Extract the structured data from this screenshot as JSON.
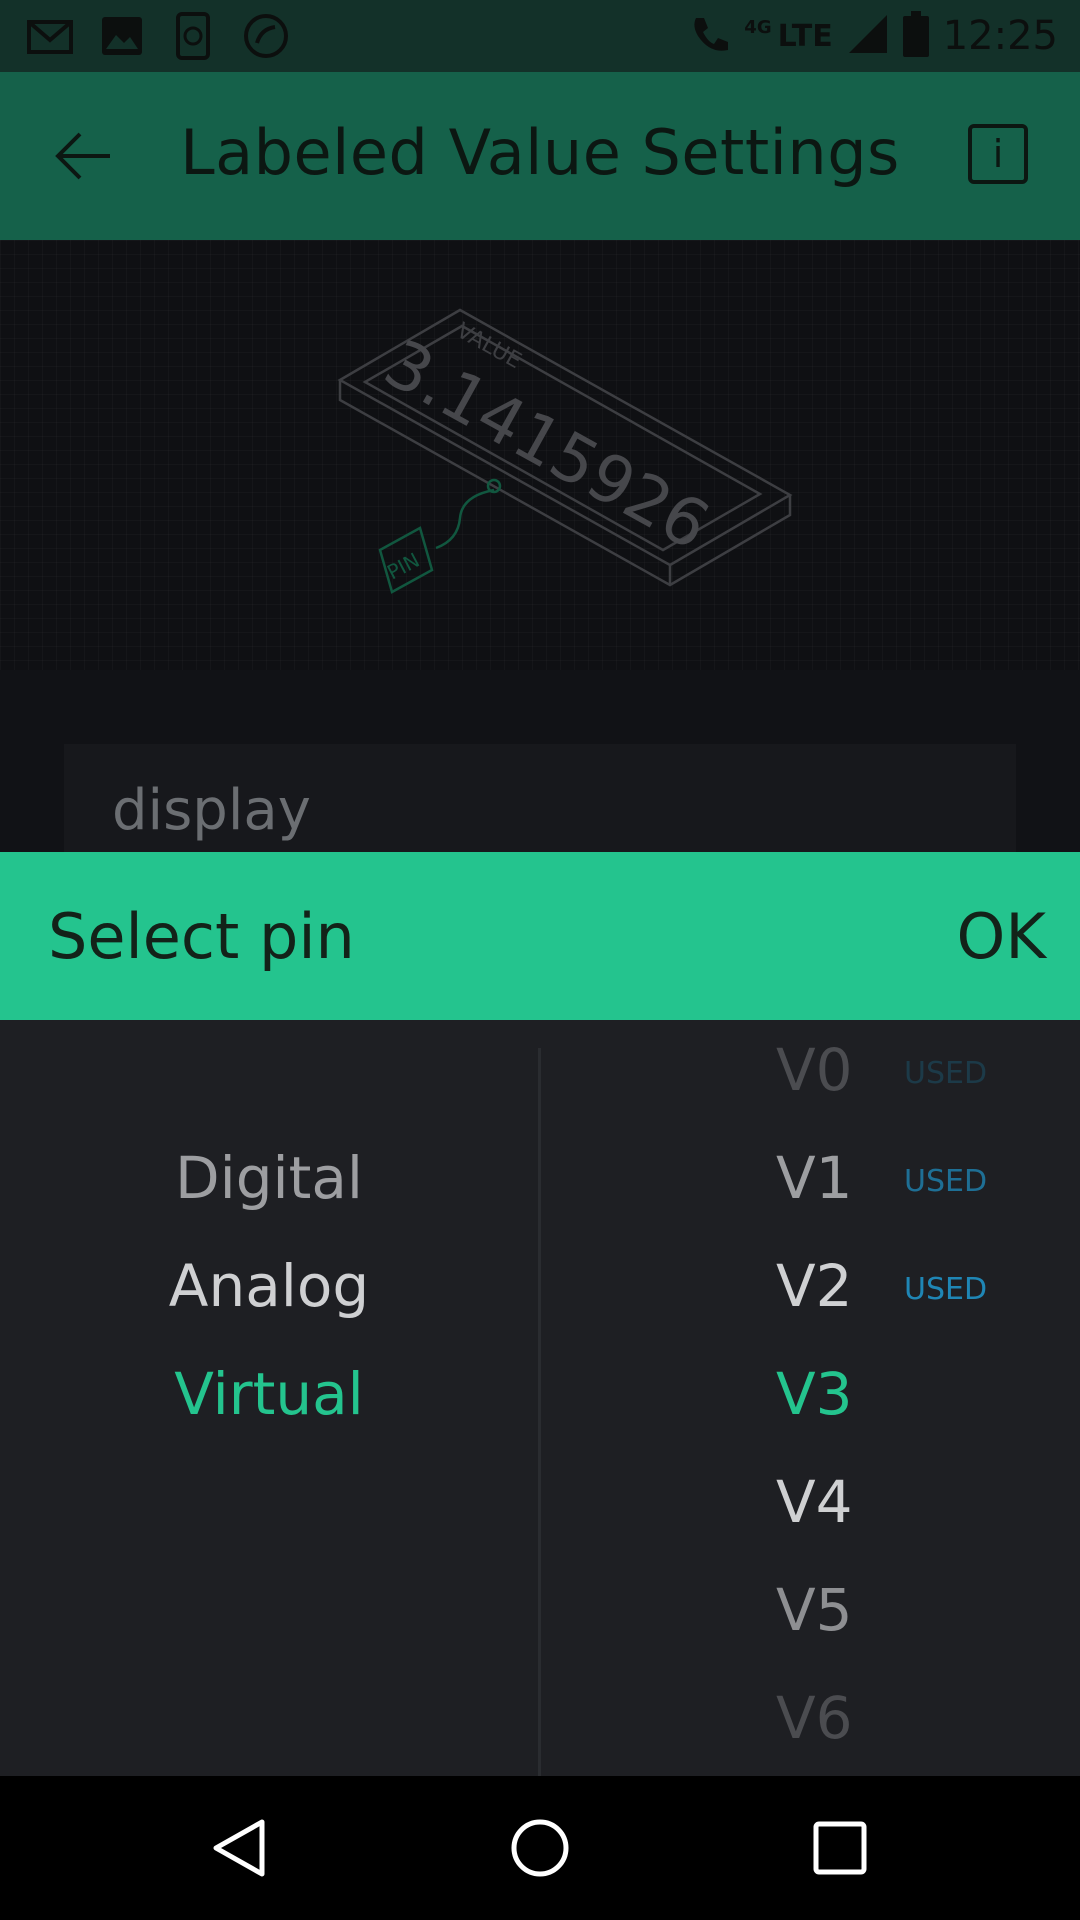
{
  "status_bar": {
    "time": "12:25",
    "network": "LTE",
    "network_sub": "4G",
    "left_icons": [
      "gmail-icon",
      "image-icon",
      "phone-sync-icon",
      "missed-call-icon"
    ],
    "right_icons": [
      "wifi-call-icon",
      "signal-icon",
      "battery-icon"
    ]
  },
  "app_bar": {
    "title": "Labeled Value Settings",
    "back_icon": "arrow-left-icon",
    "info_label": "i"
  },
  "preview": {
    "value_label": "VALUE",
    "value_text": "3.1415926",
    "pin_label": "PIN"
  },
  "name_field": {
    "value": "display"
  },
  "dialog": {
    "title": "Select pin",
    "ok_label": "OK",
    "pin_types": [
      {
        "label": "Digital",
        "state": "normal"
      },
      {
        "label": "Analog",
        "state": "normal"
      },
      {
        "label": "Virtual",
        "state": "selected"
      }
    ],
    "pins": [
      {
        "label": "V0",
        "used": "USED"
      },
      {
        "label": "V1",
        "used": "USED"
      },
      {
        "label": "V2",
        "used": "USED"
      },
      {
        "label": "V3",
        "used": ""
      },
      {
        "label": "V4",
        "used": ""
      },
      {
        "label": "V5",
        "used": ""
      },
      {
        "label": "V6",
        "used": ""
      }
    ]
  },
  "colors": {
    "accent": "#24c48e",
    "app_bar": "#15614a",
    "used_badge": "#1f86b5",
    "selected_item": "#24c48e"
  },
  "nav_bar": {
    "buttons": [
      "back-triangle-icon",
      "home-circle-icon",
      "recents-square-icon"
    ]
  }
}
